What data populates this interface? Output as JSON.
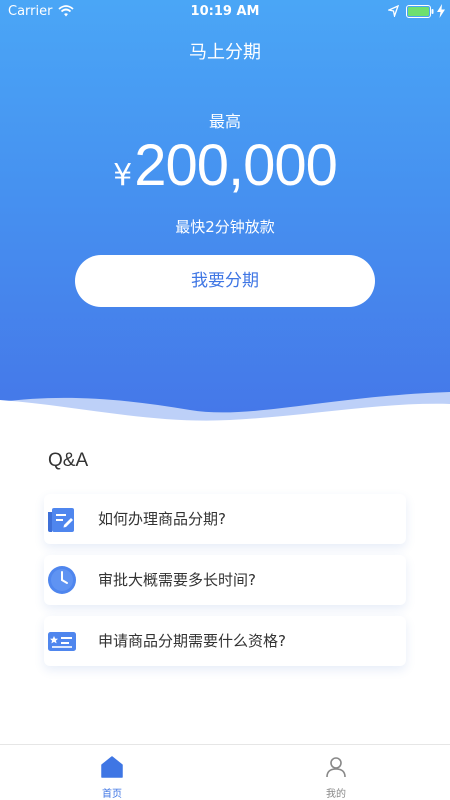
{
  "status_bar": {
    "carrier": "Carrier",
    "time": "10:19 AM"
  },
  "header": {
    "title": "马上分期"
  },
  "hero": {
    "max_label": "最高",
    "currency": "¥",
    "amount": "200,000",
    "fast_label": "最快2分钟放款",
    "apply_button": "我要分期"
  },
  "qa": {
    "title": "Q&A",
    "items": [
      {
        "text": "如何办理商品分期?",
        "icon": "document-edit-icon"
      },
      {
        "text": "审批大概需要多长时间?",
        "icon": "clock-icon"
      },
      {
        "text": "申请商品分期需要什么资格?",
        "icon": "id-card-icon"
      }
    ]
  },
  "tab_bar": {
    "items": [
      {
        "label": "首页",
        "icon": "home-icon",
        "active": true
      },
      {
        "label": "我的",
        "icon": "user-icon",
        "active": false
      }
    ]
  },
  "colors": {
    "primary": "#4576e8",
    "gradient_top": "#4aa6f6",
    "text": "#333333"
  }
}
